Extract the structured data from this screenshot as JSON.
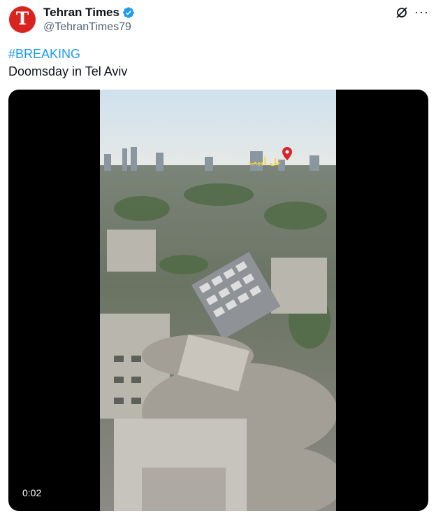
{
  "author": {
    "name": "Tehran Times",
    "handle": "@TehranTimes79",
    "avatar_letter": "T",
    "verified": true
  },
  "tweet": {
    "hashtag": "#BREAKING",
    "text": "Doomsday in Tel Aviv"
  },
  "media": {
    "type": "video",
    "timestamp": "0:02",
    "overlay_label": "تل أبيب"
  },
  "actions": {
    "grok_icon": "grok-icon",
    "more_icon": "more-options-icon",
    "more_glyph": "···"
  },
  "colors": {
    "accent": "#1d9bf0",
    "avatar_red": "#d8231f",
    "text": "#0f1419",
    "muted": "#536471"
  }
}
